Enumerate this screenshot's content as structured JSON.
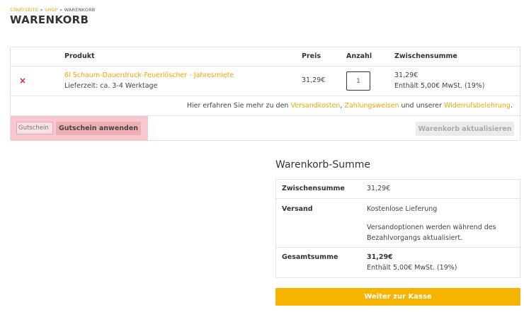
{
  "breadcrumb": {
    "items": [
      "STARTSEITE",
      "SHOP",
      "WARENKORB"
    ],
    "separator": "»"
  },
  "page_title": "WARENKORB",
  "cart": {
    "headers": {
      "product": "Produkt",
      "price": "Preis",
      "quantity": "Anzahl",
      "subtotal": "Zwischensumme"
    },
    "item": {
      "remove_symbol": "×",
      "name": "6l Schaum-Dauerdruck-Feuerlöscher - Jahresmiete",
      "delivery": "Lieferzeit: ca. 3-4 Werktage",
      "price": "31,29€",
      "quantity": "1",
      "subtotal": "31,29€",
      "tax_note": "Enthält 5,00€ MwSt. (19%)"
    },
    "info": {
      "prefix": "Hier erfahren Sie mehr zu den",
      "shipping_link": "Versandkosten",
      "comma": ",",
      "payment_link": "Zahlungsweisen",
      "middle": "und unserer",
      "withdrawal_link": "Widerrufsbelehrung",
      "suffix": "."
    },
    "coupon": {
      "placeholder": "Gutschein",
      "apply_label": "Gutschein anwenden"
    },
    "update_label": "Warenkorb aktualisieren"
  },
  "totals": {
    "title": "Warenkorb-Summe",
    "subtotal_label": "Zwischensumme",
    "subtotal_value": "31,29€",
    "shipping_label": "Versand",
    "shipping_value": "Kostenlose Lieferung",
    "shipping_note_1": "Versandoptionen werden während des",
    "shipping_note_2": "Bezahlvorgangs aktualisiert.",
    "total_label": "Gesamtsumme",
    "total_value": "31,29€",
    "total_tax": "Enthält 5,00€ MwSt. (19%)"
  },
  "checkout_label": "Weiter zur Kasse",
  "colors": {
    "accent": "#f0a800",
    "checkout": "#f6b400",
    "remove": "#d9262b",
    "highlight": "#f7c9cf"
  }
}
